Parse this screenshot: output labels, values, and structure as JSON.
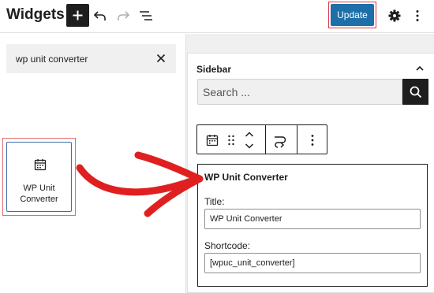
{
  "header": {
    "title": "Widgets",
    "add_icon": "plus-icon",
    "undo_icon": "undo-icon",
    "redo_icon": "redo-icon",
    "list_view_icon": "list-view-icon",
    "update_label": "Update",
    "settings_icon": "gear-icon",
    "more_icon": "more-vertical-icon"
  },
  "inserter": {
    "search_value": "wp unit converter",
    "clear_icon": "close-icon",
    "results": [
      {
        "label_line1": "WP Unit",
        "label_line2": "Converter",
        "icon": "calendar-icon"
      }
    ]
  },
  "sidebar": {
    "title": "Sidebar",
    "collapse_icon": "chevron-up-icon",
    "search_placeholder": "Search ...",
    "search_icon": "search-icon",
    "toolbar": {
      "block_icon": "calendar-icon",
      "drag_icon": "drag-handle-icon",
      "move_icon": "move-up-down-icon",
      "transform_icon": "transform-icon",
      "options_icon": "more-vertical-icon"
    },
    "widget": {
      "title": "WP Unit Converter",
      "title_label": "Title:",
      "title_value": "WP Unit Converter",
      "shortcode_label": "Shortcode:",
      "shortcode_value": "[wpuc_unit_converter]"
    }
  },
  "colors": {
    "update_bg": "#1e6fa8",
    "highlight_red": "#e02020",
    "dark": "#1e1e1e"
  }
}
